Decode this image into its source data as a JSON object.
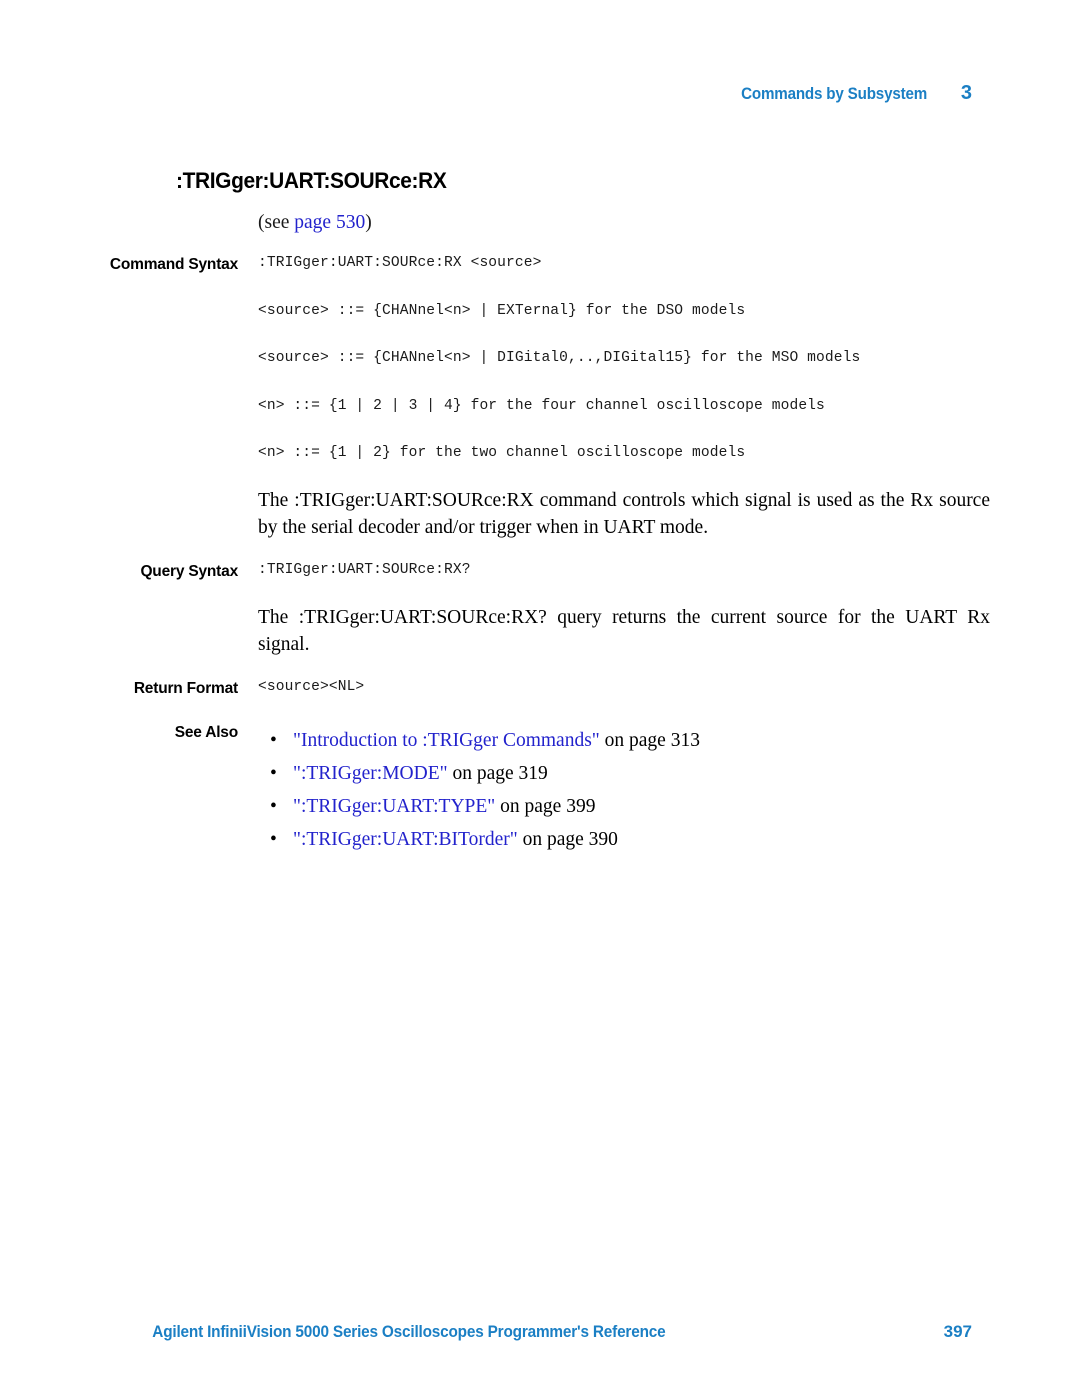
{
  "header": {
    "title": "Commands by Subsystem",
    "chapter": "3"
  },
  "command": {
    "title": ":TRIGger:UART:SOURce:RX",
    "see_prefix": "(see ",
    "see_link": "page  530",
    "see_suffix": ")"
  },
  "labels": {
    "command_syntax": "Command Syntax",
    "query_syntax": "Query Syntax",
    "return_format": "Return Format",
    "see_also": "See Also"
  },
  "command_syntax": {
    "lines": [
      ":TRIGger:UART:SOURce:RX <source>",
      "<source> ::= {CHANnel<n> | EXTernal} for the DSO models",
      "<source> ::= {CHANnel<n> | DIGital0,..,DIGital15} for the MSO models",
      "<n> ::= {1 | 2 | 3 | 4} for the four channel oscilloscope models",
      "<n> ::= {1 | 2} for the two channel oscilloscope models"
    ],
    "description": "The :TRIGger:UART:SOURce:RX command controls which signal is used as the Rx source by the serial decoder and/or trigger when in UART mode."
  },
  "query_syntax": {
    "line": ":TRIGger:UART:SOURce:RX?",
    "description": "The :TRIGger:UART:SOURce:RX? query returns the current source for the UART Rx signal."
  },
  "return_format": {
    "line": "<source><NL>"
  },
  "see_also": {
    "bullet": "•",
    "items": [
      {
        "link": "\"Introduction to :TRIGger Commands\"",
        "tail": " on page  313"
      },
      {
        "link": "\":TRIGger:MODE\"",
        "tail": " on page  319"
      },
      {
        "link": "\":TRIGger:UART:TYPE\"",
        "tail": " on page  399"
      },
      {
        "link": "\":TRIGger:UART:BITorder\"",
        "tail": " on page  390"
      }
    ]
  },
  "footer": {
    "text": "Agilent InfiniiVision 5000 Series Oscilloscopes Programmer's Reference",
    "page": "397"
  },
  "colors": {
    "accent_blue": "#1B7FC4",
    "link_blue": "#2222CC",
    "text_black": "#000000"
  }
}
